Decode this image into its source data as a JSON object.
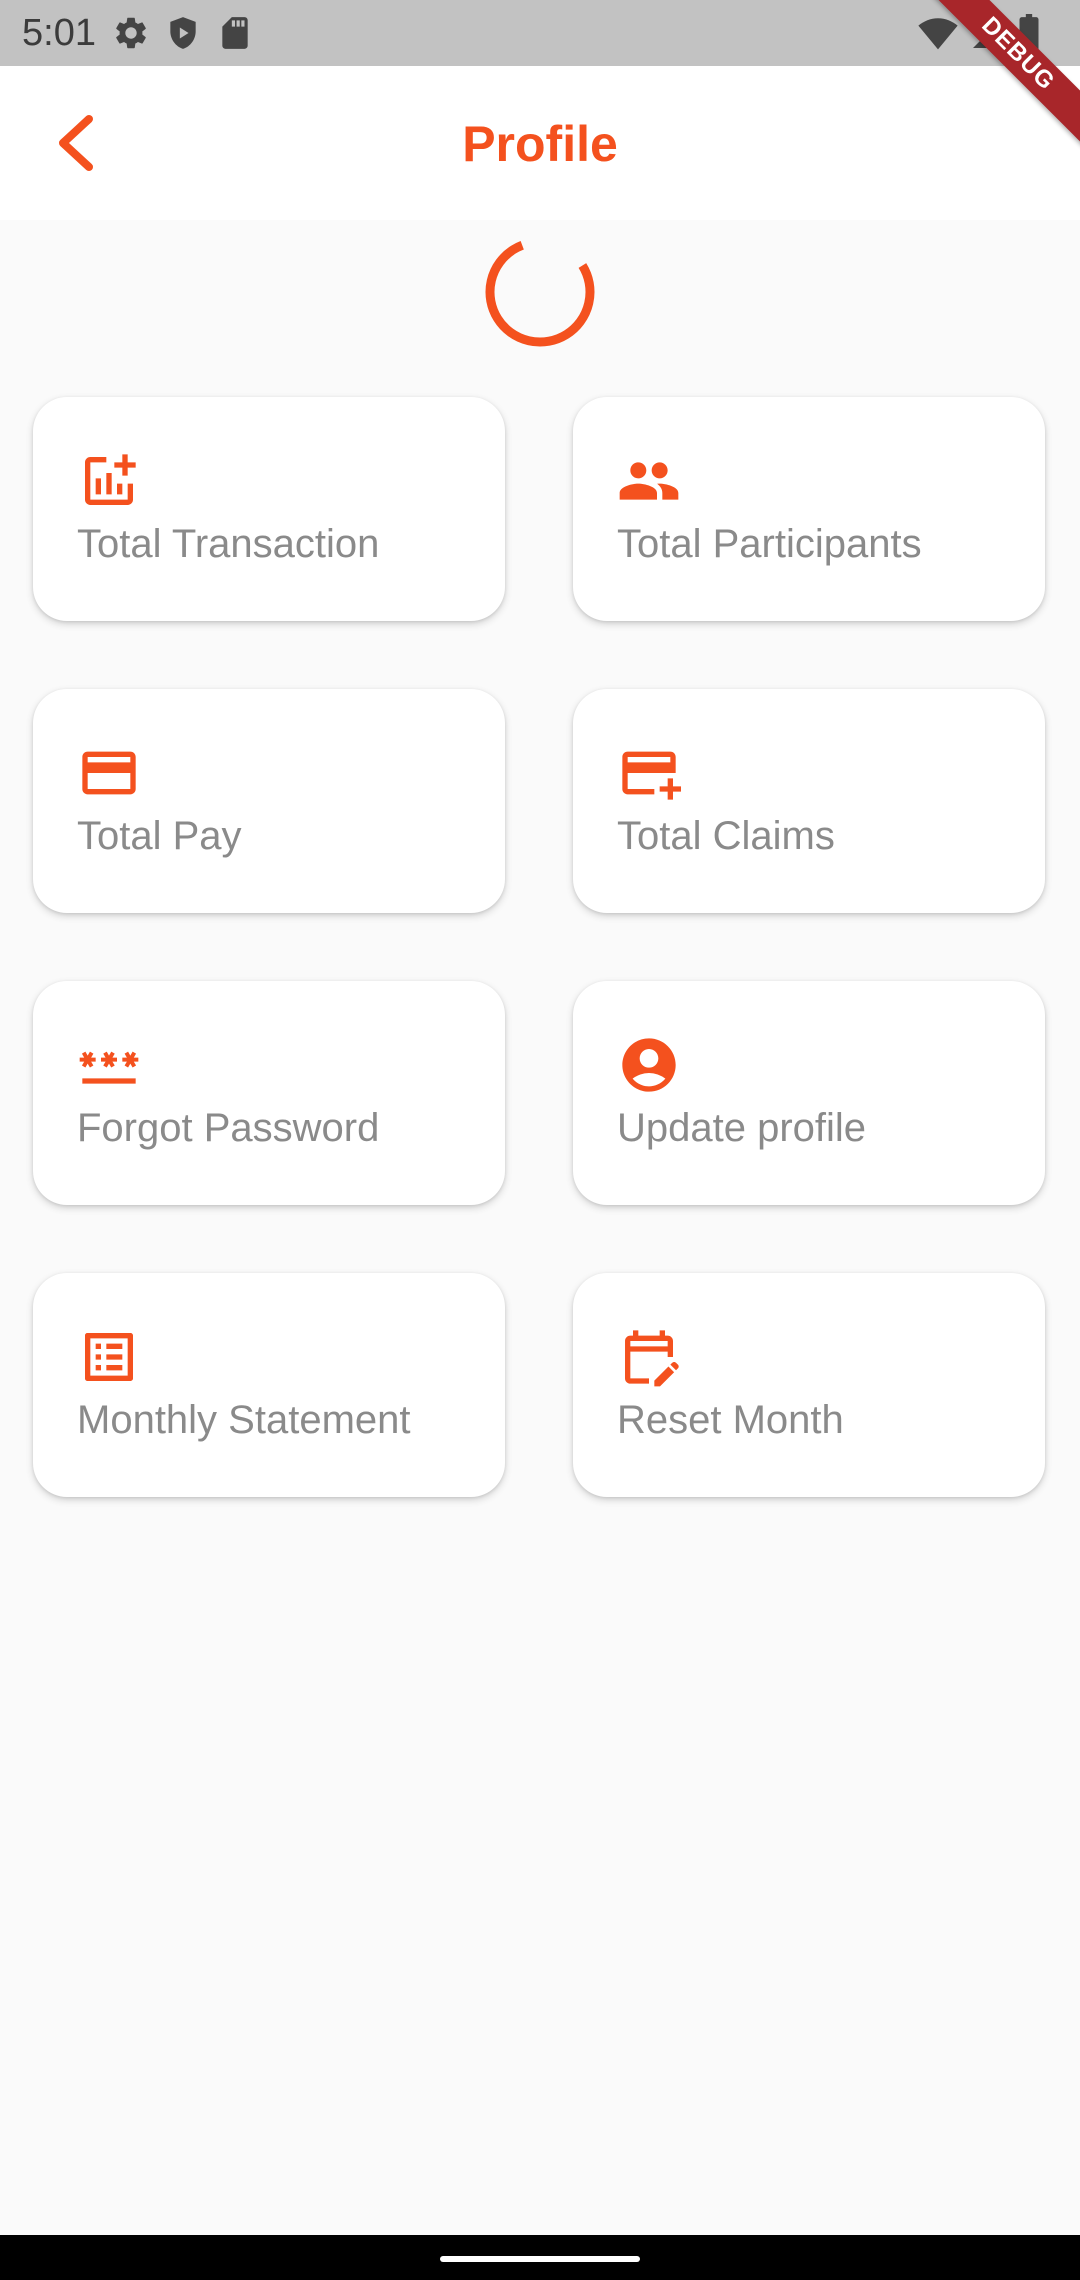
{
  "status_bar": {
    "time": "5:01",
    "left_icons": [
      "gear-icon",
      "shield-play-icon",
      "sd-card-icon"
    ],
    "right_icons": [
      "wifi-icon",
      "cell-signal-icon",
      "battery-icon"
    ]
  },
  "debug_banner": {
    "label": "DEBUG",
    "color": "#a8262a"
  },
  "app_bar": {
    "title": "Profile",
    "back_icon": "chevron-left-icon"
  },
  "colors": {
    "accent": "#f4511e",
    "label": "#8a8a8a",
    "background": "#fafafa",
    "card": "#ffffff"
  },
  "loading": {
    "indicator": "circular-progress"
  },
  "menu": {
    "items": [
      {
        "label": "Total Transaction",
        "icon": "add-chart-icon"
      },
      {
        "label": "Total Participants",
        "icon": "people-icon"
      },
      {
        "label": "Total Pay",
        "icon": "credit-card-icon"
      },
      {
        "label": "Total Claims",
        "icon": "add-card-icon"
      },
      {
        "label": "Forgot Password",
        "icon": "password-icon"
      },
      {
        "label": "Update profile",
        "icon": "account-circle-icon"
      },
      {
        "label": "Monthly Statement",
        "icon": "list-alt-icon"
      },
      {
        "label": "Reset Month",
        "icon": "edit-calendar-icon"
      }
    ]
  }
}
